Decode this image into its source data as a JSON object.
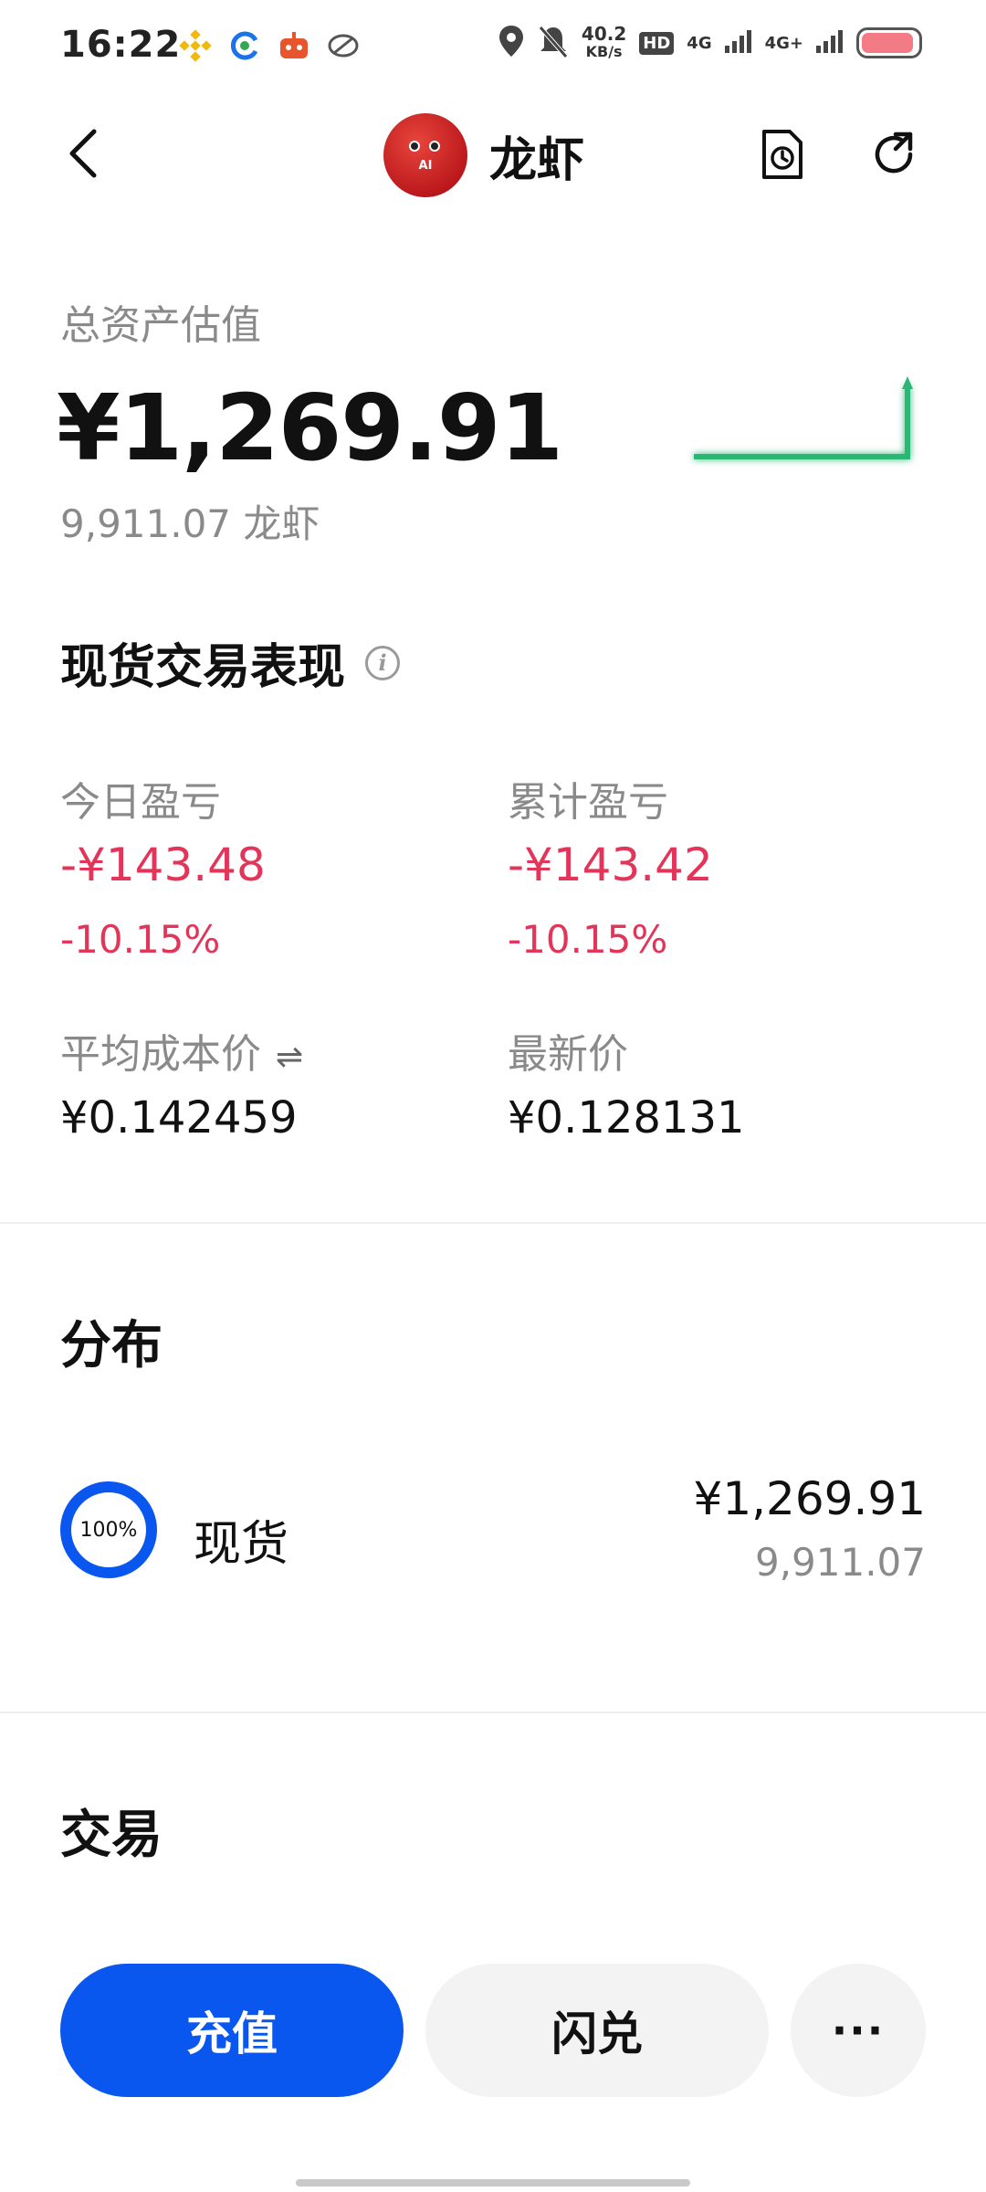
{
  "status_bar": {
    "time": "16:22",
    "network_speed_value": "40.2",
    "network_speed_unit": "KB/s",
    "hd_label": "HD",
    "sim1_label": "4G",
    "sim2_label": "4G+",
    "icons": [
      "binance-icon",
      "circle-c-icon",
      "robot-app-icon",
      "link-icon",
      "location-icon",
      "mute-icon",
      "signal-icon",
      "battery-icon"
    ]
  },
  "header": {
    "title": "龙虾",
    "avatar_text": "AI",
    "icons": [
      "back-chevron-icon",
      "history-document-icon",
      "refresh-icon"
    ]
  },
  "asset": {
    "label": "总资产估值",
    "value": "¥1,269.91",
    "sub_value": "9,911.07 龙虾",
    "chart_color": "#2bb673"
  },
  "performance": {
    "title": "现货交易表现",
    "today_pnl_label": "今日盈亏",
    "today_pnl_value": "-¥143.48",
    "today_pnl_pct": "-10.15%",
    "total_pnl_label": "累计盈亏",
    "total_pnl_value": "-¥143.42",
    "total_pnl_pct": "-10.15%",
    "avg_cost_label": "平均成本价",
    "avg_cost_value": "¥0.142459",
    "latest_price_label": "最新价",
    "latest_price_value": "¥0.128131",
    "loss_color": "#e3355a"
  },
  "distribution": {
    "title": "分布",
    "items": [
      {
        "percent_label": "100%",
        "name": "现货",
        "value": "¥1,269.91",
        "sub_value": "9,911.07"
      }
    ],
    "accent_color": "#0a57f0"
  },
  "trade": {
    "title": "交易",
    "deposit_label": "充值",
    "convert_label": "闪兑",
    "more_label": "···"
  }
}
